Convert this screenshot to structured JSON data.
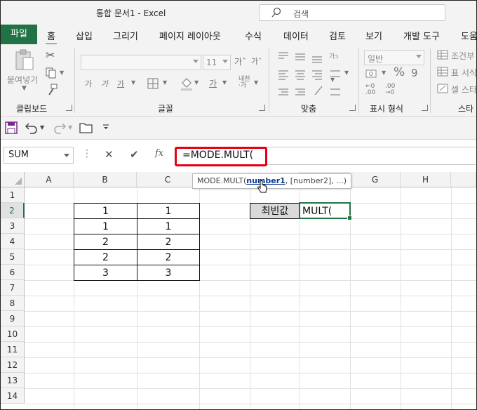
{
  "window": {
    "title": "통합 문서1  -  Excel",
    "search_placeholder": "검색"
  },
  "tabs": [
    "파일",
    "홈",
    "삽입",
    "그리기",
    "페이지 레이아웃",
    "수식",
    "데이터",
    "검토",
    "보기",
    "개발 도구",
    "도움"
  ],
  "active_tab": "홈",
  "ribbon": {
    "clipboard": {
      "label": "클립보드",
      "paste": "붙여넣기"
    },
    "font": {
      "label": "글꼴",
      "size": "11"
    },
    "alignment": {
      "label": "맞춤"
    },
    "number": {
      "label": "표시 형식",
      "format": "일반"
    },
    "styles": {
      "label": "스타",
      "conditional": "조건부",
      "table": "표 서식",
      "cell": "셀 스타"
    }
  },
  "formula_bar": {
    "name_box": "SUM",
    "fx": "fx",
    "formula": "=MODE.MULT("
  },
  "tooltip": {
    "func": "MODE.MULT(",
    "arg1": "number1",
    "rest": ", [number2], ...)"
  },
  "grid": {
    "columns": [
      "A",
      "B",
      "C",
      "D",
      "E",
      "F",
      "G",
      "H"
    ],
    "rows": [
      "1",
      "2",
      "3",
      "4",
      "5",
      "6",
      "7",
      "8",
      "9",
      "10",
      "11",
      "12",
      "13",
      "14"
    ],
    "table": [
      [
        "1",
        "1"
      ],
      [
        "1",
        "1"
      ],
      [
        "2",
        "2"
      ],
      [
        "2",
        "2"
      ],
      [
        "3",
        "3"
      ]
    ],
    "label_cell": "최빈값",
    "active_cell_text": "MULT("
  },
  "colors": {
    "excel_green": "#217346",
    "highlight_red": "#e60012",
    "label_fill": "#d9d9d9"
  }
}
